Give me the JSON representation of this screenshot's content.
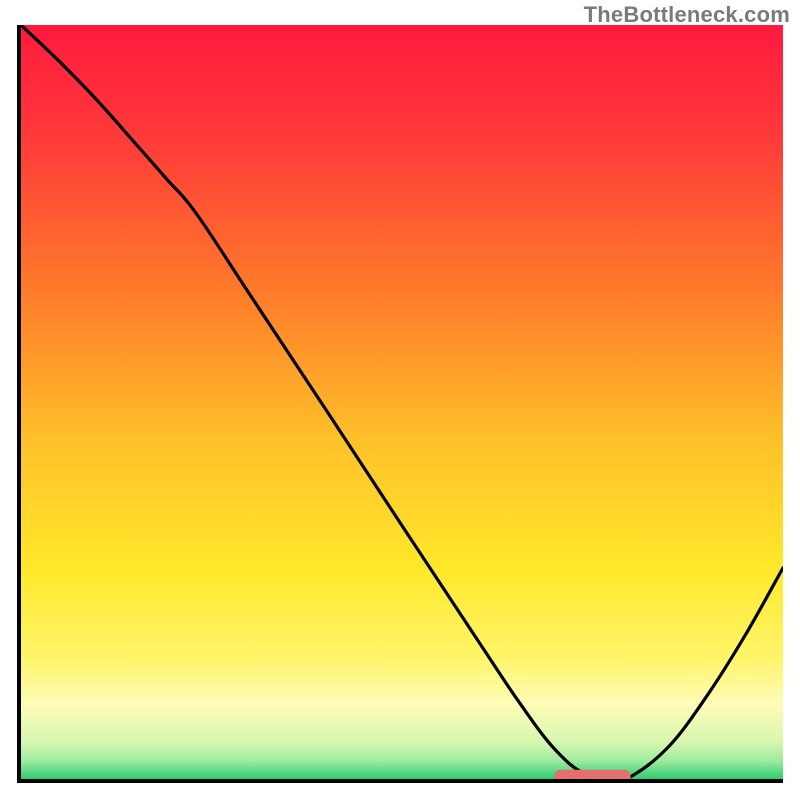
{
  "watermark": "TheBottleneck.com",
  "chart_data": {
    "type": "line",
    "title": "",
    "xlabel": "",
    "ylabel": "",
    "xlim": [
      0,
      1
    ],
    "ylim": [
      0,
      1
    ],
    "x": [
      0.0,
      0.05,
      0.1,
      0.15,
      0.19,
      0.23,
      0.3,
      0.4,
      0.5,
      0.6,
      0.655,
      0.7,
      0.74,
      0.78,
      0.8,
      0.85,
      0.9,
      0.95,
      1.0
    ],
    "y": [
      1.0,
      0.952,
      0.9,
      0.843,
      0.797,
      0.75,
      0.643,
      0.49,
      0.336,
      0.183,
      0.1,
      0.04,
      0.007,
      0.003,
      0.003,
      0.043,
      0.11,
      0.19,
      0.28
    ],
    "gradient_stops": [
      {
        "offset": 0.0,
        "color": "#ff1a3e"
      },
      {
        "offset": 0.15,
        "color": "#ff3a3a"
      },
      {
        "offset": 0.35,
        "color": "#ff7a2a"
      },
      {
        "offset": 0.55,
        "color": "#ffc02a"
      },
      {
        "offset": 0.72,
        "color": "#ffe82a"
      },
      {
        "offset": 0.84,
        "color": "#fff56a"
      },
      {
        "offset": 0.9,
        "color": "#fffcb8"
      },
      {
        "offset": 0.95,
        "color": "#d8f7b0"
      },
      {
        "offset": 0.975,
        "color": "#a0eca0"
      },
      {
        "offset": 1.0,
        "color": "#2ecc71"
      }
    ],
    "highlight_pill": {
      "x_start": 0.7,
      "x_end": 0.8,
      "y": 0.003,
      "color": "#e36f6f"
    }
  }
}
